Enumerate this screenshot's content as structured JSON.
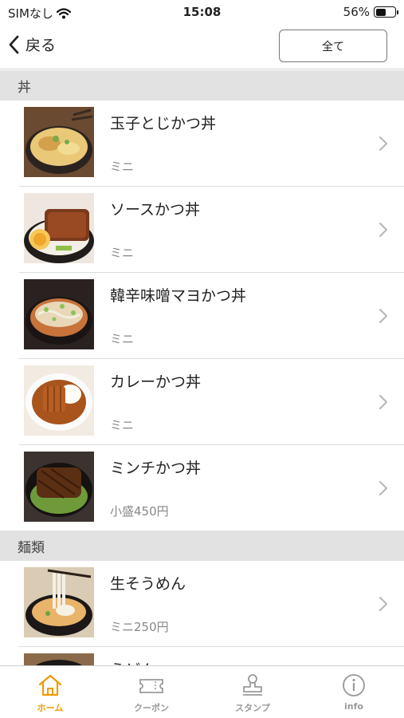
{
  "status_bar": {
    "carrier": "SIMなし",
    "time": "15:08",
    "battery": "56%",
    "battery_level": 0.56
  },
  "nav": {
    "back_label": "戻る",
    "all_button": "全て"
  },
  "sections": [
    {
      "title": "丼",
      "items": [
        {
          "name": "玉子とじかつ丼",
          "sub": "ミニ"
        },
        {
          "name": "ソースかつ丼",
          "sub": "ミニ"
        },
        {
          "name": "韓辛味噌マヨかつ丼",
          "sub": "ミニ"
        },
        {
          "name": "カレーかつ丼",
          "sub": "ミニ"
        },
        {
          "name": "ミンチかつ丼",
          "sub": "小盛450円"
        }
      ]
    },
    {
      "title": "麺類",
      "items": [
        {
          "name": "生そうめん",
          "sub": "ミニ250円"
        },
        {
          "name": "うどん",
          "sub": ""
        }
      ]
    }
  ],
  "tabs": [
    {
      "label": "ホーム",
      "icon": "home-icon",
      "active": true
    },
    {
      "label": "クーポン",
      "icon": "ticket-icon",
      "active": false
    },
    {
      "label": "スタンプ",
      "icon": "stamp-icon",
      "active": false
    },
    {
      "label": "info",
      "icon": "info-icon",
      "active": false
    }
  ],
  "colors": {
    "accent": "#f29a00",
    "section_bg": "#e2e2e2",
    "muted_text": "#888888"
  }
}
